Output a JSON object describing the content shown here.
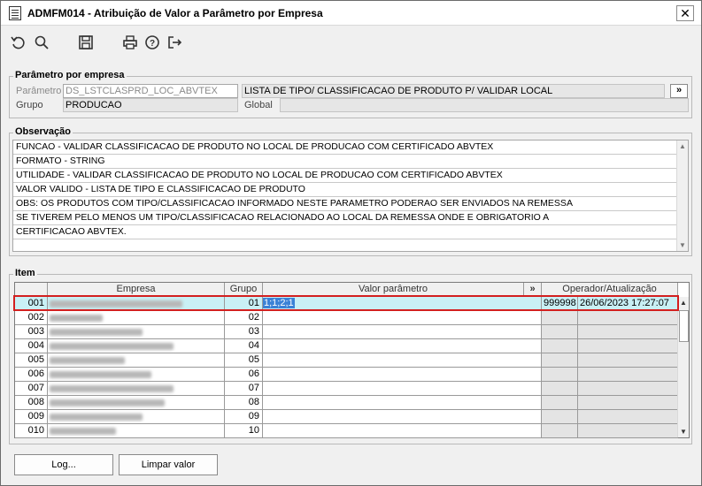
{
  "window": {
    "title": "ADMFM014 - Atribuição de Valor a Parâmetro por Empresa",
    "close_label": "✕"
  },
  "toolbar": {
    "icons": [
      "undo-icon",
      "search-icon",
      "save-icon",
      "print-icon",
      "help-icon",
      "exit-icon"
    ]
  },
  "parametro_section": {
    "title": "Parâmetro por empresa",
    "parametro_label": "Parâmetro",
    "parametro_value": "DS_LSTCLASPRD_LOC_ABVTEX",
    "parametro_desc": "LISTA DE TIPO/ CLASSIFICACAO DE PRODUTO P/ VALIDAR LOCAL",
    "ellipsis": "»",
    "grupo_label": "Grupo",
    "grupo_value": "PRODUCAO",
    "global_label": "Global",
    "global_value": ""
  },
  "observacao_section": {
    "title": "Observação",
    "lines": [
      "FUNCAO - VALIDAR CLASSIFICACAO DE PRODUTO NO LOCAL DE PRODUCAO COM CERTIFICADO ABVTEX",
      "FORMATO - STRING",
      "UTILIDADE - VALIDAR CLASSIFICACAO DE PRODUTO NO LOCAL DE PRODUCAO COM CERTIFICADO ABVTEX",
      "VALOR VALIDO - LISTA DE TIPO E CLASSIFICACAO DE PRODUTO",
      "OBS: OS PRODUTOS COM TIPO/CLASSIFICACAO INFORMADO NESTE PARAMETRO PODERAO SER ENVIADOS  NA REMESSA",
      "SE TIVEREM PELO MENOS UM TIPO/CLASSIFICACAO RELACIONADO AO LOCAL DA REMESSA ONDE E OBRIGATORIO A",
      "CERTIFICACAO ABVTEX."
    ]
  },
  "item_section": {
    "title": "Item",
    "headers": {
      "empresa": "Empresa",
      "grupo": "Grupo",
      "valor": "Valor parâmetro",
      "expand": "»",
      "operador": "Operador/Atualização"
    },
    "rows": [
      {
        "code": "001",
        "grupo": "01",
        "valor": "1;1;2;1",
        "operador": "999998",
        "data": "26/06/2023 17:27:07"
      },
      {
        "code": "002",
        "grupo": "02",
        "valor": "",
        "operador": "",
        "data": ""
      },
      {
        "code": "003",
        "grupo": "03",
        "valor": "",
        "operador": "",
        "data": ""
      },
      {
        "code": "004",
        "grupo": "04",
        "valor": "",
        "operador": "",
        "data": ""
      },
      {
        "code": "005",
        "grupo": "05",
        "valor": "",
        "operador": "",
        "data": ""
      },
      {
        "code": "006",
        "grupo": "06",
        "valor": "",
        "operador": "",
        "data": ""
      },
      {
        "code": "007",
        "grupo": "07",
        "valor": "",
        "operador": "",
        "data": ""
      },
      {
        "code": "008",
        "grupo": "08",
        "valor": "",
        "operador": "",
        "data": ""
      },
      {
        "code": "009",
        "grupo": "09",
        "valor": "",
        "operador": "",
        "data": ""
      },
      {
        "code": "010",
        "grupo": "10",
        "valor": "",
        "operador": "",
        "data": ""
      }
    ]
  },
  "buttons": {
    "log": "Log...",
    "limpar": "Limpar valor"
  }
}
